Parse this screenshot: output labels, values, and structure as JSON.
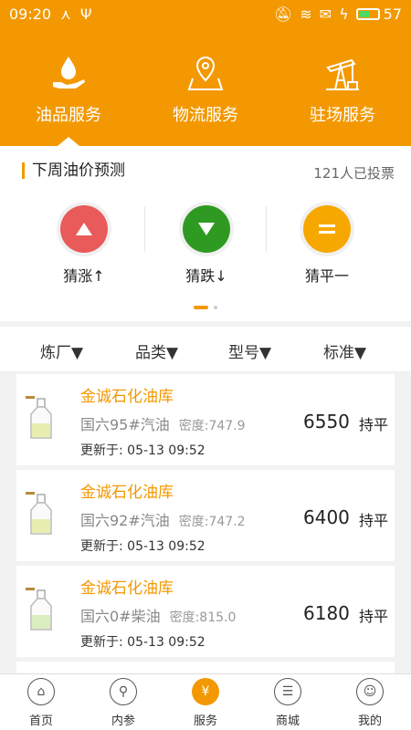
{
  "status": {
    "time": "09:20",
    "battery": "57"
  },
  "services": [
    {
      "label": "油品服务"
    },
    {
      "label": "物流服务"
    },
    {
      "label": "驻场服务"
    }
  ],
  "forecast": {
    "title": "下周油价预测",
    "votes": "121人已投票",
    "options": [
      {
        "label": "猜涨↑",
        "color": "#e95a5a",
        "symbol": "▲"
      },
      {
        "label": "猜跌↓",
        "color": "#2f9a22",
        "symbol": "▼"
      },
      {
        "label": "猜平一",
        "color": "#f7a800",
        "symbol": "="
      }
    ]
  },
  "filters": [
    "炼厂▼",
    "品类▼",
    "型号▼",
    "标准▼"
  ],
  "products": [
    {
      "name": "金诚石化油库",
      "grade": "国六95#汽油",
      "density": "密度:747.9",
      "price": "6550",
      "trend": "持平",
      "updated": "更新于: 05-13 09:52"
    },
    {
      "name": "金诚石化油库",
      "grade": "国六92#汽油",
      "density": "密度:747.2",
      "price": "6400",
      "trend": "持平",
      "updated": "更新于: 05-13 09:52"
    },
    {
      "name": "金诚石化油库",
      "grade": "国六0#柴油",
      "density": "密度:815.0",
      "price": "6180",
      "trend": "持平",
      "updated": "更新于: 05-13 09:52"
    }
  ],
  "tabs": [
    {
      "label": "首页",
      "icon": "home-icon"
    },
    {
      "label": "内参",
      "icon": "search-icon"
    },
    {
      "label": "服务",
      "icon": "yen-icon"
    },
    {
      "label": "商城",
      "icon": "cart-icon"
    },
    {
      "label": "我的",
      "icon": "user-icon"
    }
  ],
  "colors": {
    "brand": "#f39800",
    "up": "#e95a5a",
    "down": "#2f9a22",
    "flat": "#f7a800"
  }
}
